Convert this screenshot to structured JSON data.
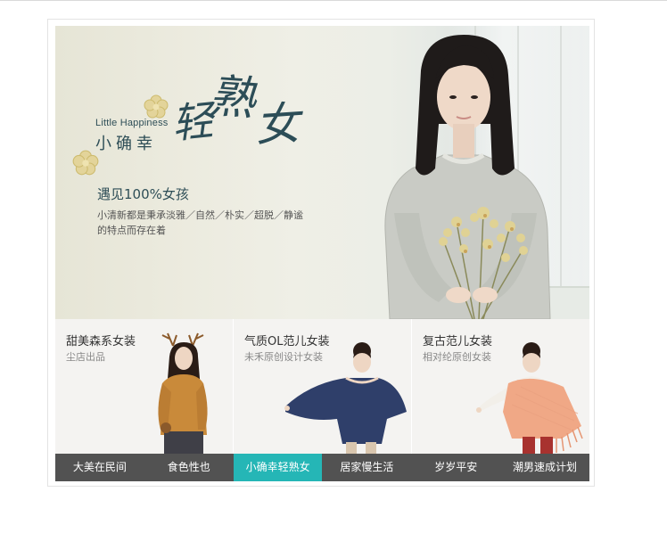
{
  "hero": {
    "tag_en": "Little Happiness",
    "tag_cn": "小确幸",
    "script_chars": [
      "轻",
      "熟",
      "女"
    ],
    "headline": "遇见100%女孩",
    "desc_line1": "小清新都是秉承淡雅／自然／朴实／超脱／静谧",
    "desc_line2": "的特点而存在着"
  },
  "cards": [
    {
      "title": "甜美森系女装",
      "subtitle": "尘店出品"
    },
    {
      "title": "气质OL范儿女装",
      "subtitle": "未禾原创设计女装"
    },
    {
      "title": "复古范儿女装",
      "subtitle": "相对纶原创女装"
    }
  ],
  "nav": {
    "items": [
      "大美在民间",
      "食色性也",
      "小确幸轻熟女",
      "居家慢生活",
      "岁岁平安",
      "潮男速成计划"
    ],
    "active_index": 2
  },
  "colors": {
    "nav_bg": "#525252",
    "nav_active": "#25b6b6",
    "title_ink": "#2e4e57"
  }
}
